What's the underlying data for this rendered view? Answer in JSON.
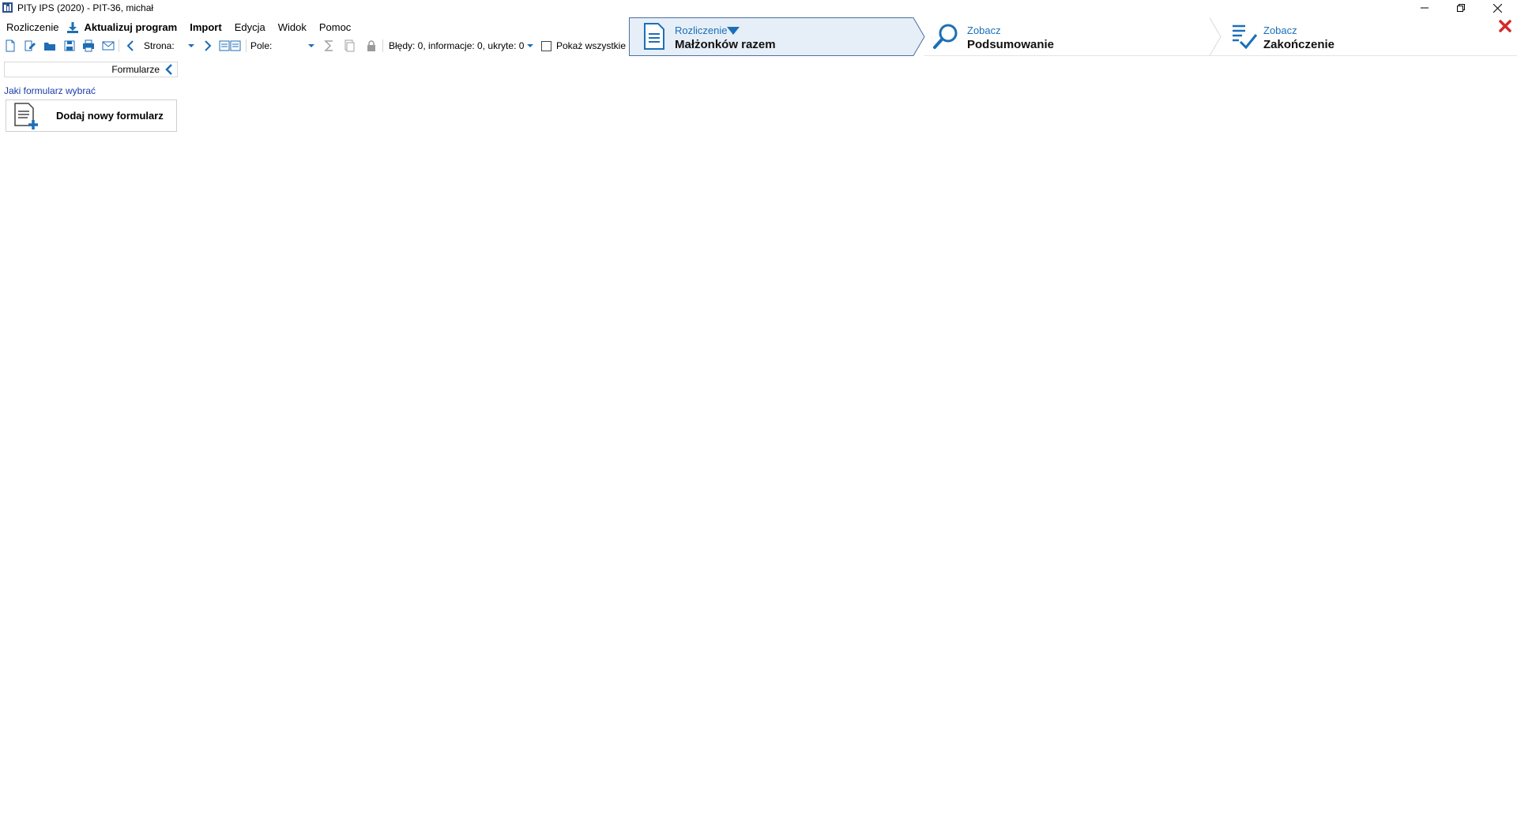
{
  "window": {
    "title": "PITy IPS (2020) - PIT-36, michał"
  },
  "menu": {
    "rozliczenie": "Rozliczenie",
    "aktualizuj": "Aktualizuj program",
    "import": "Import",
    "edycja": "Edycja",
    "widok": "Widok",
    "pomoc": "Pomoc"
  },
  "toolbar": {
    "strona_label": "Strona:",
    "pole_label": "Pole:",
    "status": "Błędy: 0, informacje: 0, ukryte: 0",
    "pokaz_wszystkie": "Pokaż wszystkie"
  },
  "steps": [
    {
      "small": "Rozliczenie",
      "big": "Małżonków razem",
      "icon": "document-icon",
      "active": true
    },
    {
      "small": "Zobacz",
      "big": "Podsumowanie",
      "icon": "magnifier-icon",
      "active": false
    },
    {
      "small": "Zobacz",
      "big": "Zakończenie",
      "icon": "checklist-icon",
      "active": false
    }
  ],
  "panel": {
    "title": "Formularze",
    "link": "Jaki formularz wybrać",
    "add_button": "Dodaj nowy formularz"
  },
  "colors": {
    "accent": "#1b6fb8",
    "active_step_bg": "#e6eef7",
    "close_red": "#d42a2a",
    "link": "#1a3ea8"
  }
}
